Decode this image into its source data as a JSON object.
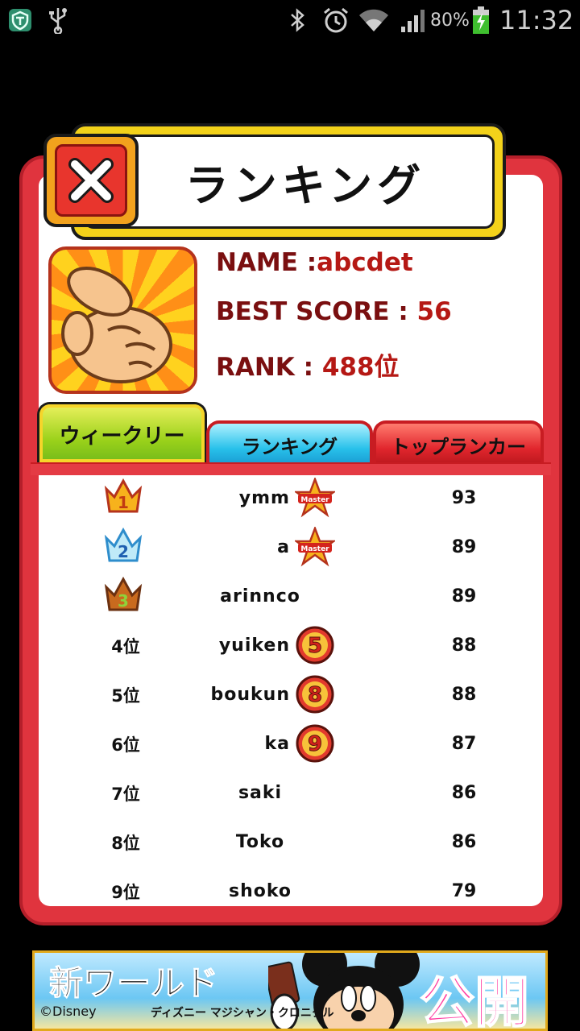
{
  "status_bar": {
    "battery_percent": "80%",
    "time": "11:32",
    "icons": [
      "shield-icon",
      "usb-icon",
      "bluetooth-icon",
      "alarm-icon",
      "wifi-icon",
      "signal-icon",
      "battery-charging-icon"
    ]
  },
  "dialog": {
    "title": "ランキング",
    "close_icon": "close-icon"
  },
  "profile": {
    "name_label": "NAME :",
    "name_value": "abcdet",
    "best_score_label": "BEST SCORE : ",
    "best_score_value": "56",
    "rank_label": "RANK : ",
    "rank_value": "488位"
  },
  "tabs": [
    {
      "label": "ウィークリー",
      "active": true
    },
    {
      "label": "ランキング",
      "active": false
    },
    {
      "label": "トップランカー",
      "active": false
    }
  ],
  "rankings": [
    {
      "rank": "1",
      "medal": "gold",
      "name": "ymm",
      "badge": "Master",
      "score": "93"
    },
    {
      "rank": "2",
      "medal": "silver",
      "name": "a",
      "badge": "Master",
      "score": "89"
    },
    {
      "rank": "3",
      "medal": "bronze",
      "name": "arinnco",
      "badge": "",
      "score": "89"
    },
    {
      "rank": "4位",
      "medal": "",
      "name": "yuiken",
      "badge": "5",
      "score": "88"
    },
    {
      "rank": "5位",
      "medal": "",
      "name": "boukun",
      "badge": "8",
      "score": "88"
    },
    {
      "rank": "6位",
      "medal": "",
      "name": "ka",
      "badge": "9",
      "score": "87"
    },
    {
      "rank": "7位",
      "medal": "",
      "name": "saki",
      "badge": "",
      "score": "86"
    },
    {
      "rank": "8位",
      "medal": "",
      "name": "Toko",
      "badge": "",
      "score": "86"
    },
    {
      "rank": "9位",
      "medal": "",
      "name": "shoko",
      "badge": "",
      "score": "79"
    }
  ],
  "ad": {
    "title": "新ワールド",
    "open_text": "公開",
    "copyright": "©Disney",
    "subtitle": "ディズニー マジシャン・クロニクル"
  },
  "colors": {
    "panel_red": "#e0343e",
    "title_yellow": "#f3d21a",
    "info_text": "#7a0f10",
    "info_value": "#b51814"
  }
}
